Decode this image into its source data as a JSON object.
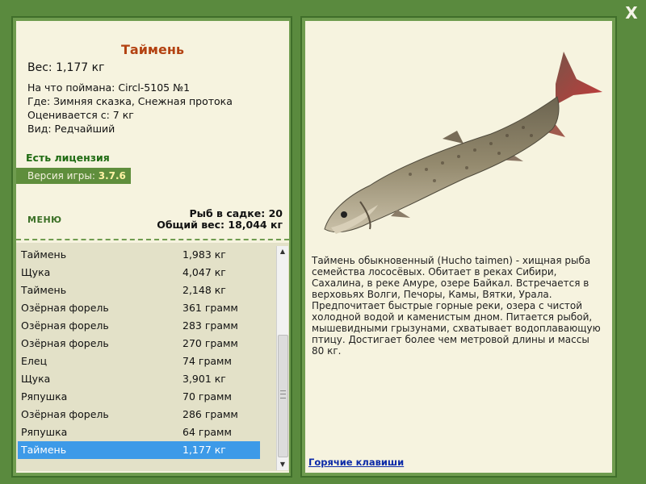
{
  "close": {
    "label": "X"
  },
  "fish": {
    "title": "Таймень",
    "weight_label": "Вес:",
    "weight": "1,177 кг",
    "details": [
      {
        "label": "На что поймана:",
        "value": "Circl-5105 №1"
      },
      {
        "label": "Где:",
        "value": "Зимняя сказка, Снежная протока"
      },
      {
        "label": "Оценивается с:",
        "value": "7 кг"
      },
      {
        "label": "Вид:",
        "value": "Редчайший"
      }
    ]
  },
  "license": "Есть лицензия",
  "version": {
    "label": "Версия игры:",
    "value": "3.7.6"
  },
  "menu": "МЕНЮ",
  "stats": {
    "cage_label": "Рыб в садке:",
    "cage_count": "20",
    "total_label": "Общий вес:",
    "total_weight": "18,044 кг"
  },
  "catch_list": [
    {
      "name": "Таймень",
      "weight": "1,983 кг"
    },
    {
      "name": "Щука",
      "weight": "4,047 кг"
    },
    {
      "name": "Таймень",
      "weight": "2,148 кг"
    },
    {
      "name": "Озёрная форель",
      "weight": "361 грамм"
    },
    {
      "name": "Озёрная форель",
      "weight": "283 грамм"
    },
    {
      "name": "Озёрная форель",
      "weight": "270 грамм"
    },
    {
      "name": "Елец",
      "weight": "74 грамм"
    },
    {
      "name": "Щука",
      "weight": "3,901 кг"
    },
    {
      "name": "Ряпушка",
      "weight": "70 грамм"
    },
    {
      "name": "Озёрная форель",
      "weight": "286 грамм"
    },
    {
      "name": "Ряпушка",
      "weight": "64 грамм"
    },
    {
      "name": "Таймень",
      "weight": "1,177 кг",
      "selected": true
    }
  ],
  "description": "Таймень обыкновенный (Hucho taimen) - хищная рыба семейства лососёвых. Обитает в реках Сибири, Сахалина, в реке Амуре, озере Байкал. Встречается в верховьях Волги, Печоры, Камы, Вятки, Урала. Предпочитает быстрые горные реки, озера с чистой холодной водой и каменистым дном. Питается рыбой, мышевидными грызунами, схватывает водоплавающую птицу. Достигает более чем метровой длины и массы 80 кг.",
  "hotkeys": "Горячие клавиши",
  "colors": {
    "frame": "#5a8a3e",
    "panel_bg": "#f6f3df",
    "title": "#b34212",
    "license": "#1f6b12",
    "selection": "#3d9ae8",
    "link": "#0c2aa8"
  },
  "icons": {
    "close": "close-icon",
    "scroll_up": "arrow-up-icon",
    "scroll_down": "arrow-down-icon"
  }
}
